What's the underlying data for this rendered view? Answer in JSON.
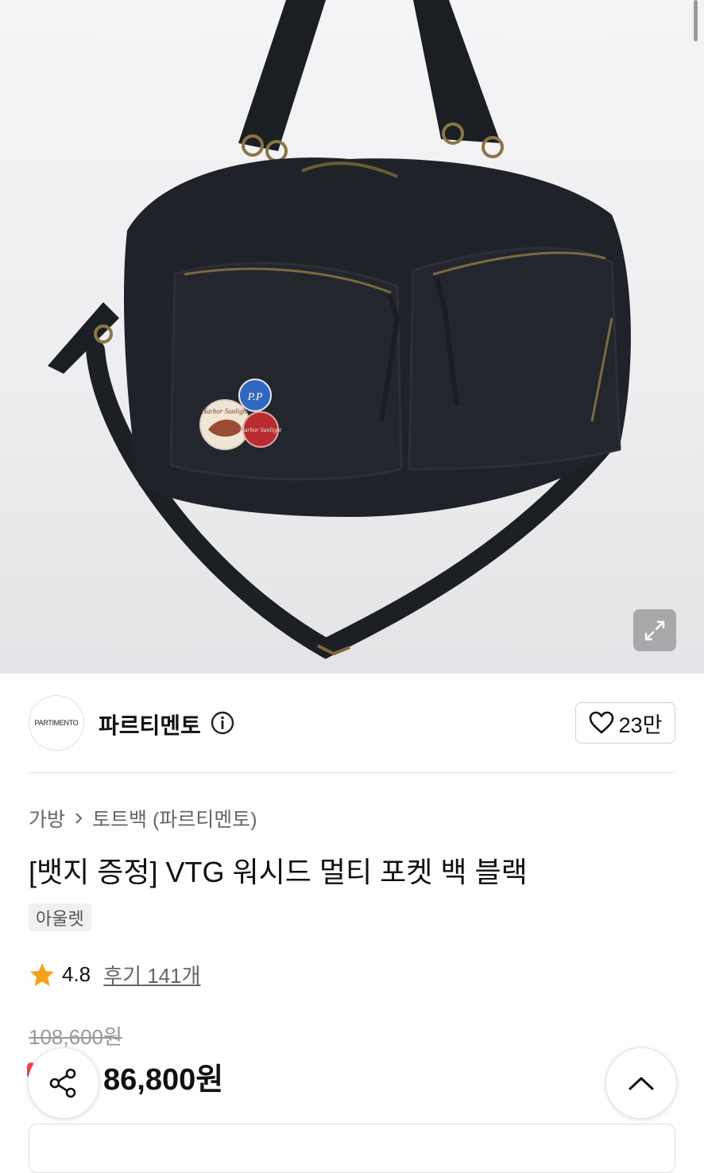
{
  "hero": {
    "image_alt": "black washed multi pocket bag",
    "badges": [
      "P.P",
      "Harbor Sunlight",
      "Harbor Sunlight"
    ]
  },
  "brand": {
    "logo_text": "PARTIMENTO",
    "name": "파르티멘토",
    "like_count": "23만"
  },
  "breadcrumb": {
    "items": [
      "가방",
      "토트백 (파르티멘토)"
    ]
  },
  "product": {
    "title": "[뱃지 증정] VTG 워시드 멀티 포켓 백 블랙",
    "badge": "아울렛",
    "rating": "4.8",
    "review_label": "후기 141개",
    "original_price": "108,600원",
    "sale_price": "86,800원"
  },
  "colors": {
    "star": "#f7a21b",
    "discount": "#f2434f"
  }
}
